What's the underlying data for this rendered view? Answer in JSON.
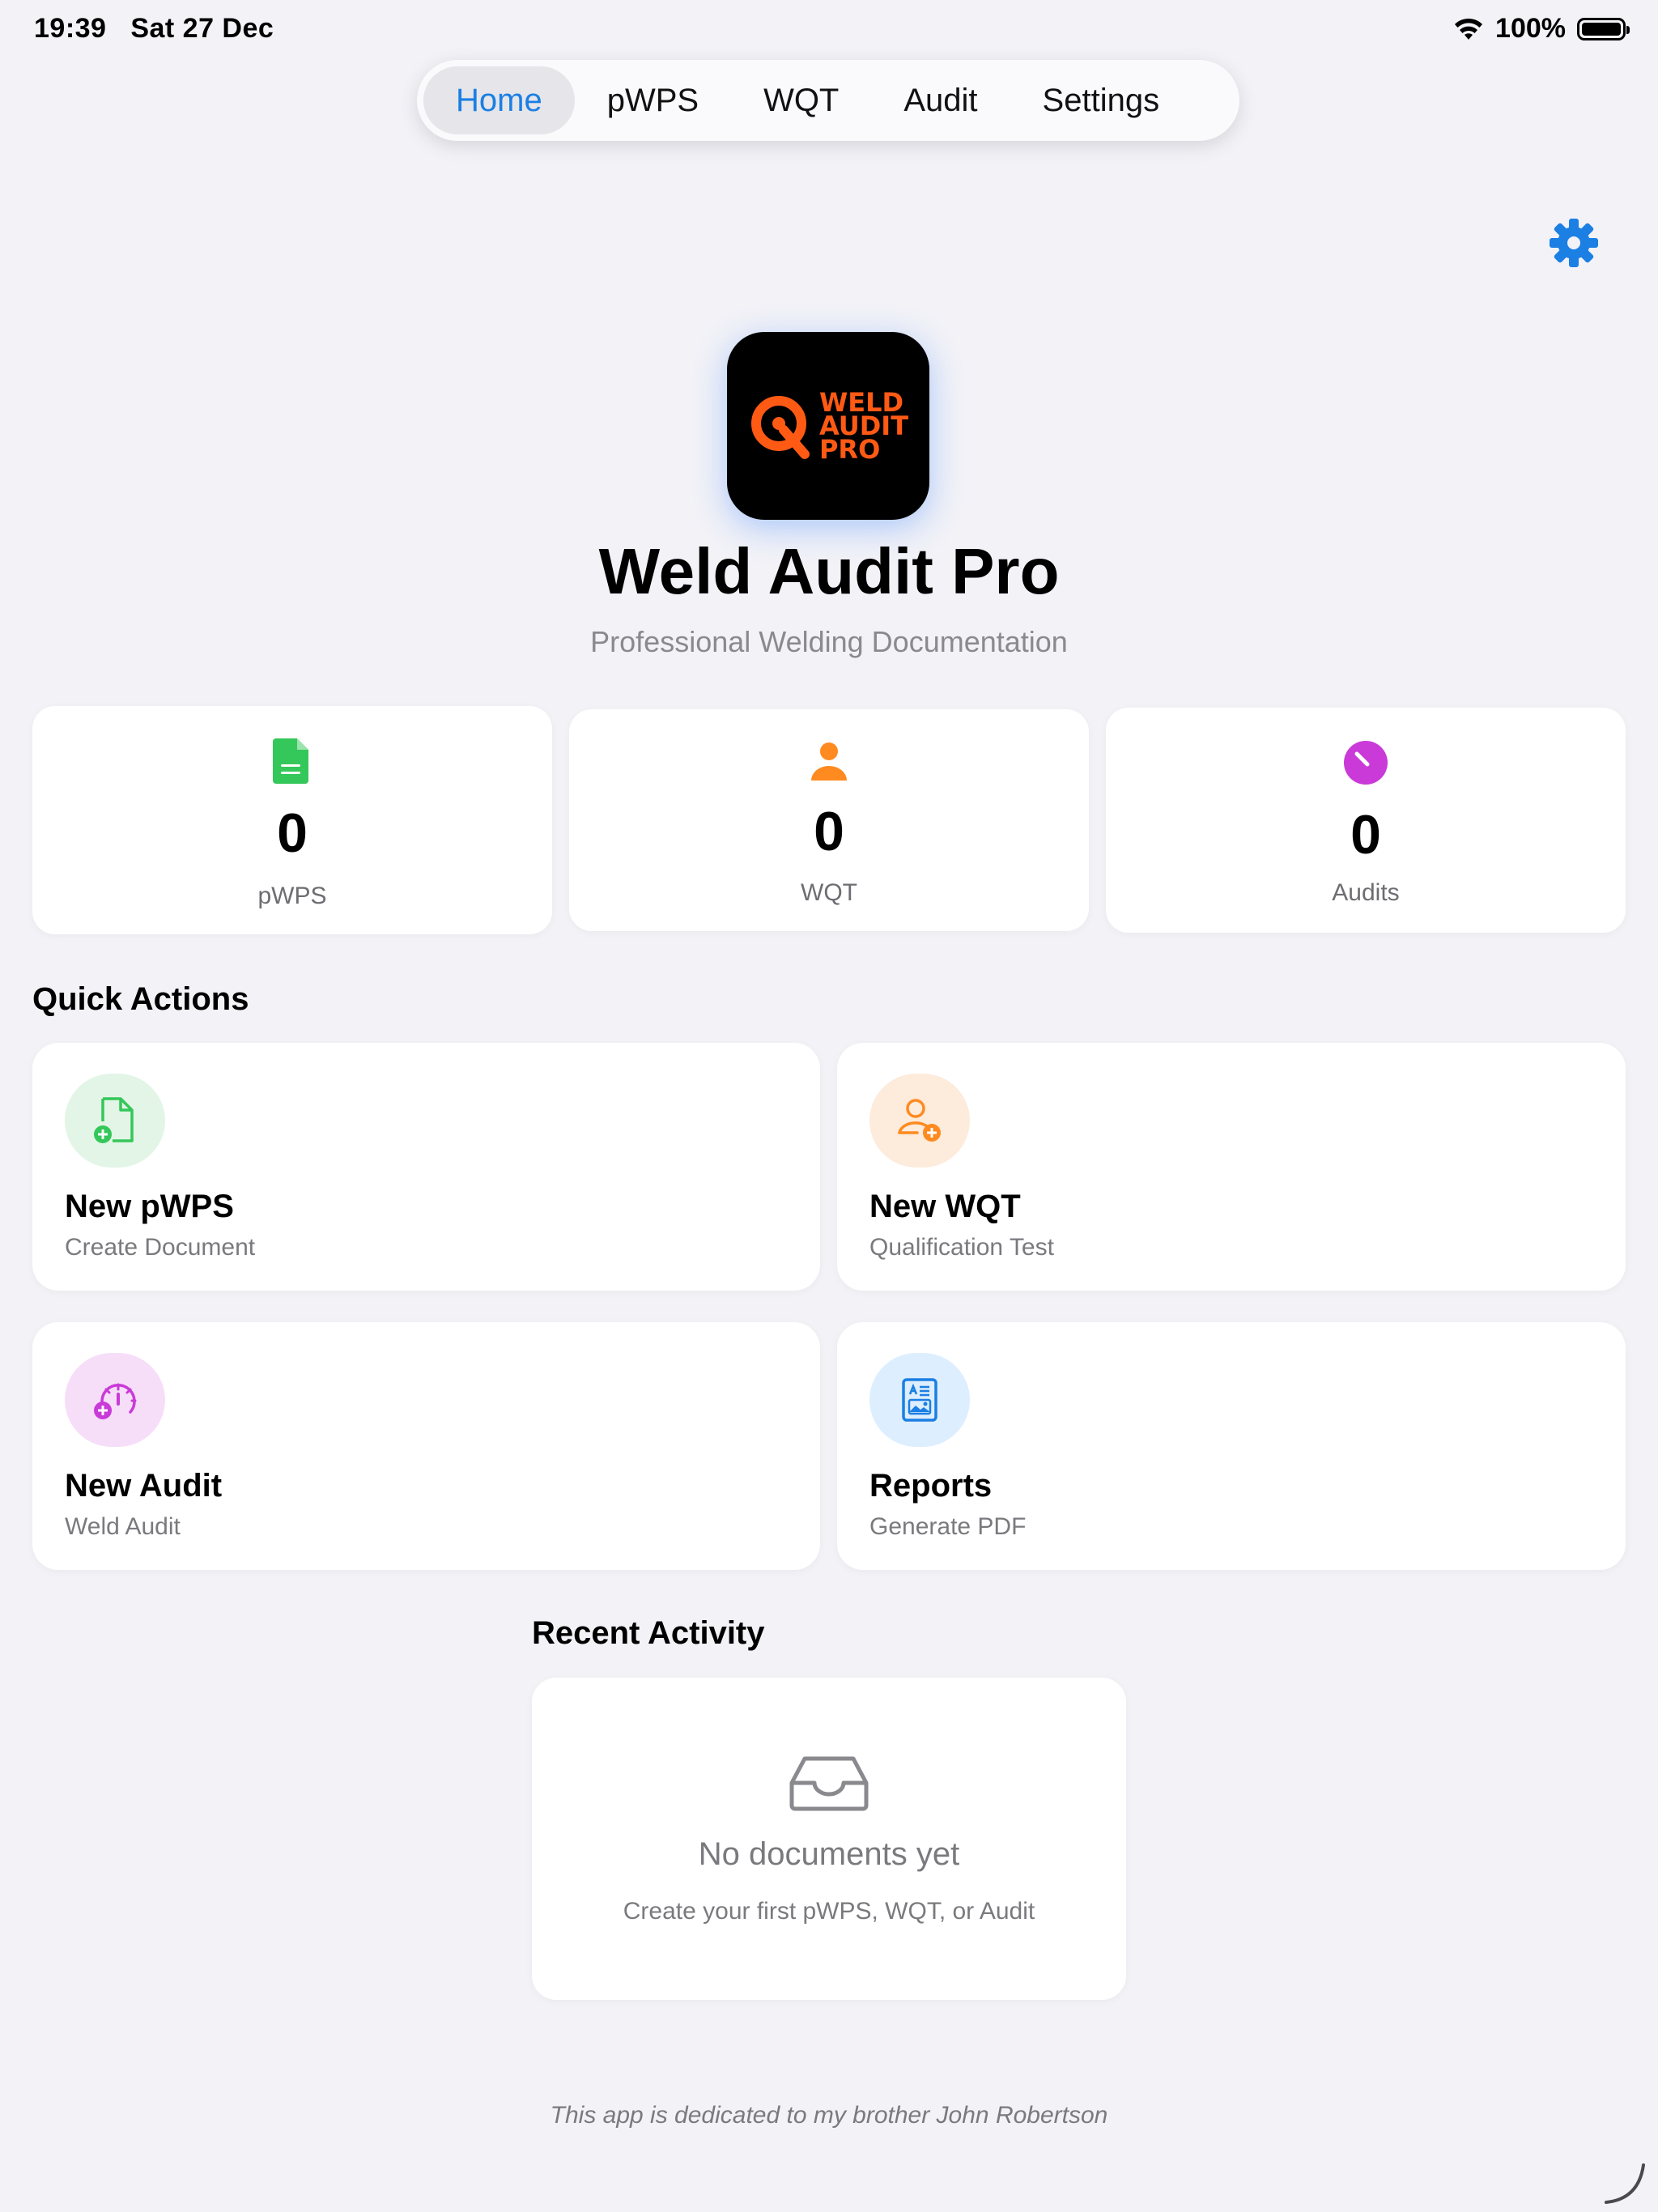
{
  "status_bar": {
    "time": "19:39",
    "date": "Sat 27 Dec",
    "battery": "100%",
    "wifi_icon": "wifi-icon",
    "battery_icon": "battery-icon"
  },
  "tabs": [
    {
      "label": "Home",
      "active": true
    },
    {
      "label": "pWPS",
      "active": false
    },
    {
      "label": "WQT",
      "active": false
    },
    {
      "label": "Audit",
      "active": false
    },
    {
      "label": "Settings",
      "active": false
    }
  ],
  "header": {
    "settings_icon": "gear-icon"
  },
  "app": {
    "logo_text": [
      "WELD",
      "AUDIT",
      "PRO"
    ],
    "title": "Weld Audit Pro",
    "subtitle": "Professional Welding Documentation"
  },
  "stats": [
    {
      "value": "0",
      "label": "pWPS",
      "icon": "document-icon",
      "color": "#34c759"
    },
    {
      "value": "0",
      "label": "WQT",
      "icon": "person-icon",
      "color": "#ff8a1f"
    },
    {
      "value": "0",
      "label": "Audits",
      "icon": "gauge-icon",
      "color": "#c93ad8"
    }
  ],
  "quick_actions": {
    "title": "Quick Actions",
    "items": [
      {
        "title": "New pWPS",
        "subtitle": "Create Document",
        "icon": "document-plus-icon",
        "color": "#34c759",
        "bg": "#e3f5e6"
      },
      {
        "title": "New WQT",
        "subtitle": "Qualification Test",
        "icon": "person-plus-icon",
        "color": "#ff8a1f",
        "bg": "#fdebdc"
      },
      {
        "title": "New Audit",
        "subtitle": "Weld Audit",
        "icon": "gauge-plus-icon",
        "color": "#c93ad8",
        "bg": "#f6def8"
      },
      {
        "title": "Reports",
        "subtitle": "Generate PDF",
        "icon": "report-icon",
        "color": "#1b7fe3",
        "bg": "#ddeeff"
      }
    ]
  },
  "recent_activity": {
    "title": "Recent Activity",
    "empty_icon": "tray-icon",
    "empty_title": "No documents yet",
    "empty_subtitle": "Create your first pWPS, WQT, or Audit"
  },
  "footer": {
    "dedication": "This app is dedicated to my brother John Robertson"
  }
}
